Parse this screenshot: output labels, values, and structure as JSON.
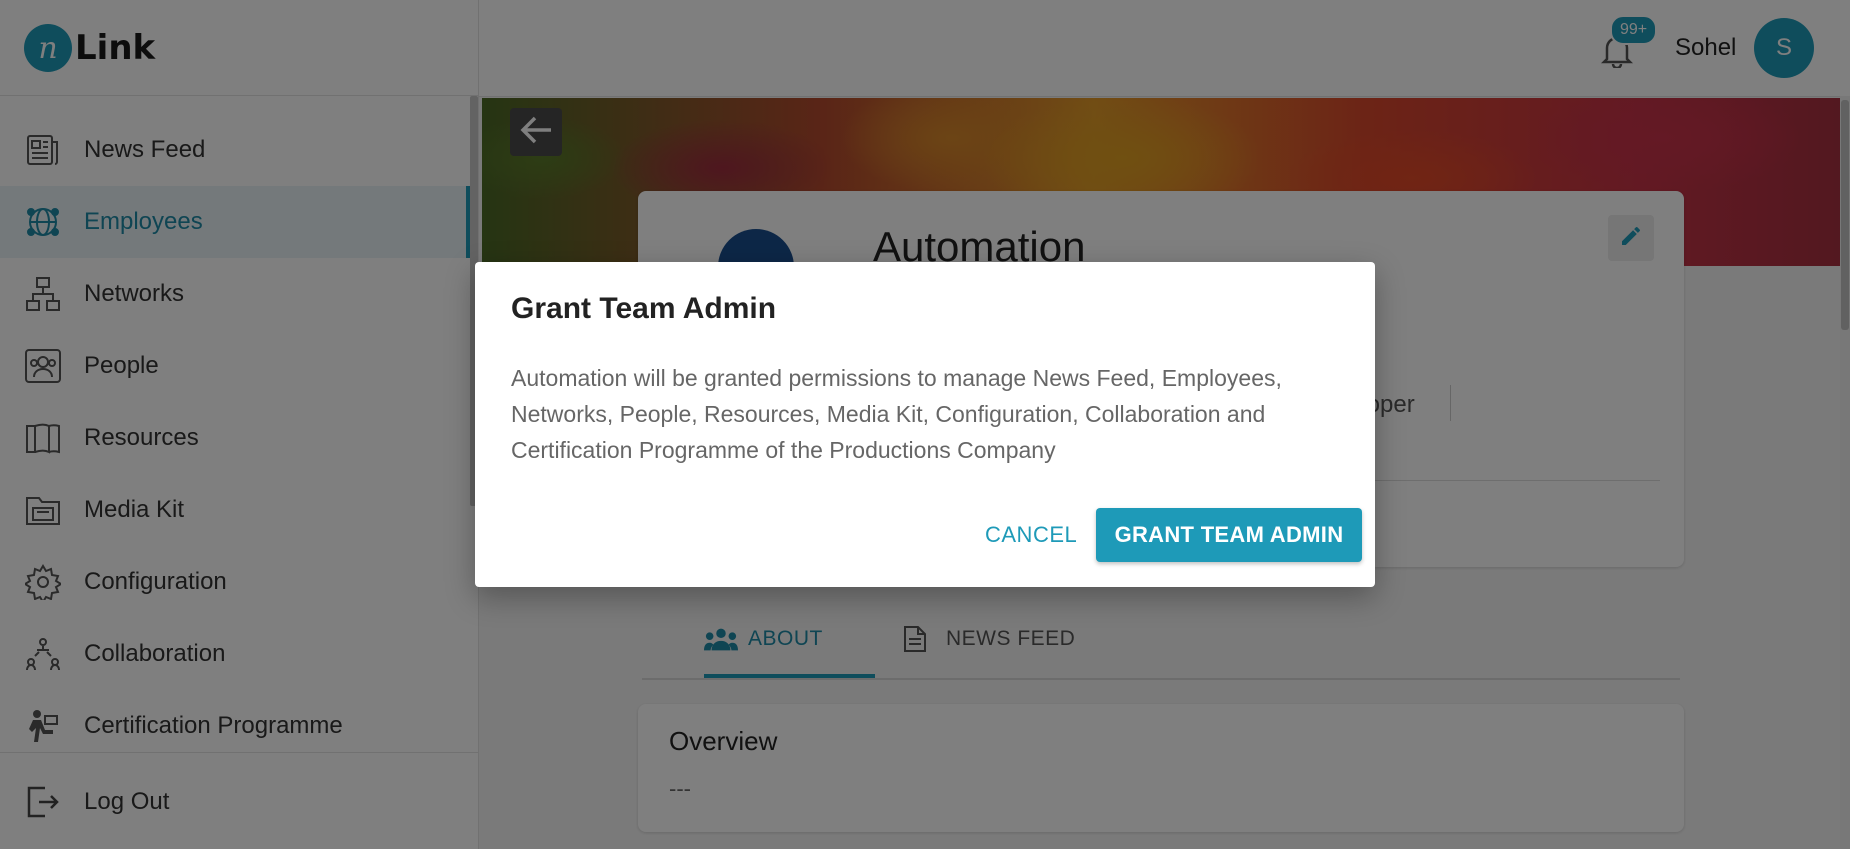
{
  "logo": {
    "mark": "n",
    "text": "Link"
  },
  "sidebar": {
    "items": [
      {
        "label": "News Feed",
        "icon": "news-feed-icon",
        "active": false
      },
      {
        "label": "Employees",
        "icon": "employees-globe-icon",
        "active": true
      },
      {
        "label": "Networks",
        "icon": "networks-icon",
        "active": false
      },
      {
        "label": "People",
        "icon": "people-icon",
        "active": false
      },
      {
        "label": "Resources",
        "icon": "resources-book-icon",
        "active": false
      },
      {
        "label": "Media Kit",
        "icon": "media-kit-folder-icon",
        "active": false
      },
      {
        "label": "Configuration",
        "icon": "gear-icon",
        "active": false
      },
      {
        "label": "Collaboration",
        "icon": "collaboration-icon",
        "active": false
      },
      {
        "label": "Certification Programme",
        "icon": "certification-icon",
        "active": false
      }
    ],
    "logout": {
      "label": "Log Out",
      "icon": "logout-icon"
    }
  },
  "header": {
    "notification_badge": "99+",
    "username": "Sohel",
    "avatar_initial": "S"
  },
  "profile": {
    "name": "Automation",
    "role_fragment": "eloper"
  },
  "tabs": [
    {
      "label": "ABOUT",
      "active": true
    },
    {
      "label": "NEWS FEED",
      "active": false
    }
  ],
  "overview": {
    "title": "Overview",
    "value": "---"
  },
  "dialog": {
    "title": "Grant Team Admin",
    "body": "Automation will be granted permissions to manage News Feed, Employees, Networks, People, Resources, Media Kit, Configuration, Collaboration and Certification Programme of the Productions Company",
    "cancel_label": "CANCEL",
    "confirm_label": "GRANT TEAM ADMIN"
  },
  "colors": {
    "accent": "#1e9ab8",
    "overlay": "rgba(0,0,0,0.5)"
  }
}
